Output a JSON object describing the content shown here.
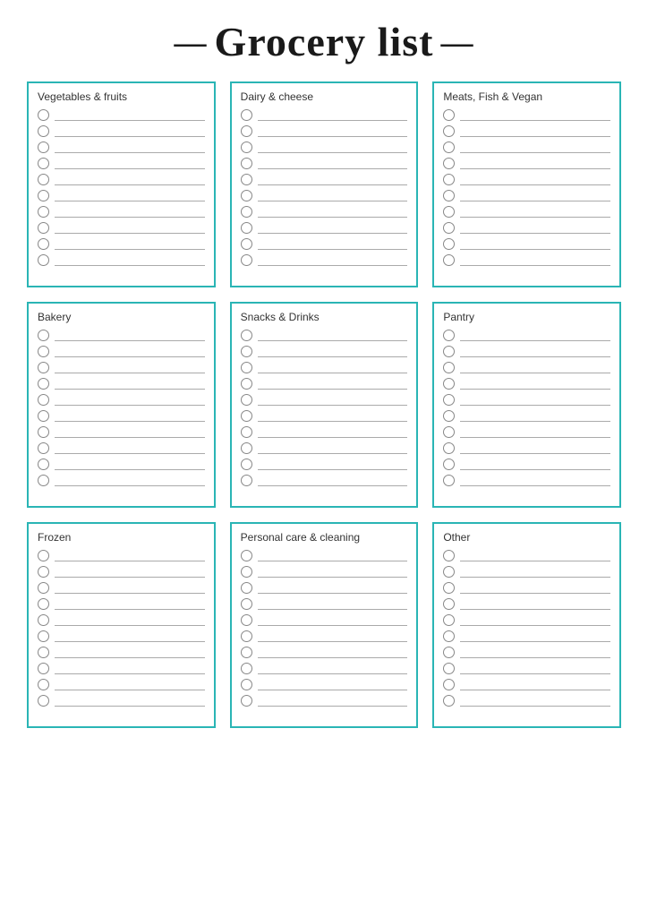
{
  "title": {
    "prefix_dash": "—",
    "main": "Grocery list",
    "suffix_dash": "—"
  },
  "categories": [
    {
      "id": "vegetables-fruits",
      "label": "Vegetables & fruits",
      "rows": 10
    },
    {
      "id": "dairy-cheese",
      "label": "Dairy & cheese",
      "rows": 10
    },
    {
      "id": "meats-fish-vegan",
      "label": "Meats, Fish & Vegan",
      "rows": 10
    },
    {
      "id": "bakery",
      "label": "Bakery",
      "rows": 10
    },
    {
      "id": "snacks-drinks",
      "label": "Snacks & Drinks",
      "rows": 10
    },
    {
      "id": "pantry",
      "label": "Pantry",
      "rows": 10
    },
    {
      "id": "frozen",
      "label": "Frozen",
      "rows": 10
    },
    {
      "id": "personal-care-cleaning",
      "label": "Personal care & cleaning",
      "rows": 10
    },
    {
      "id": "other",
      "label": "Other",
      "rows": 10
    }
  ]
}
